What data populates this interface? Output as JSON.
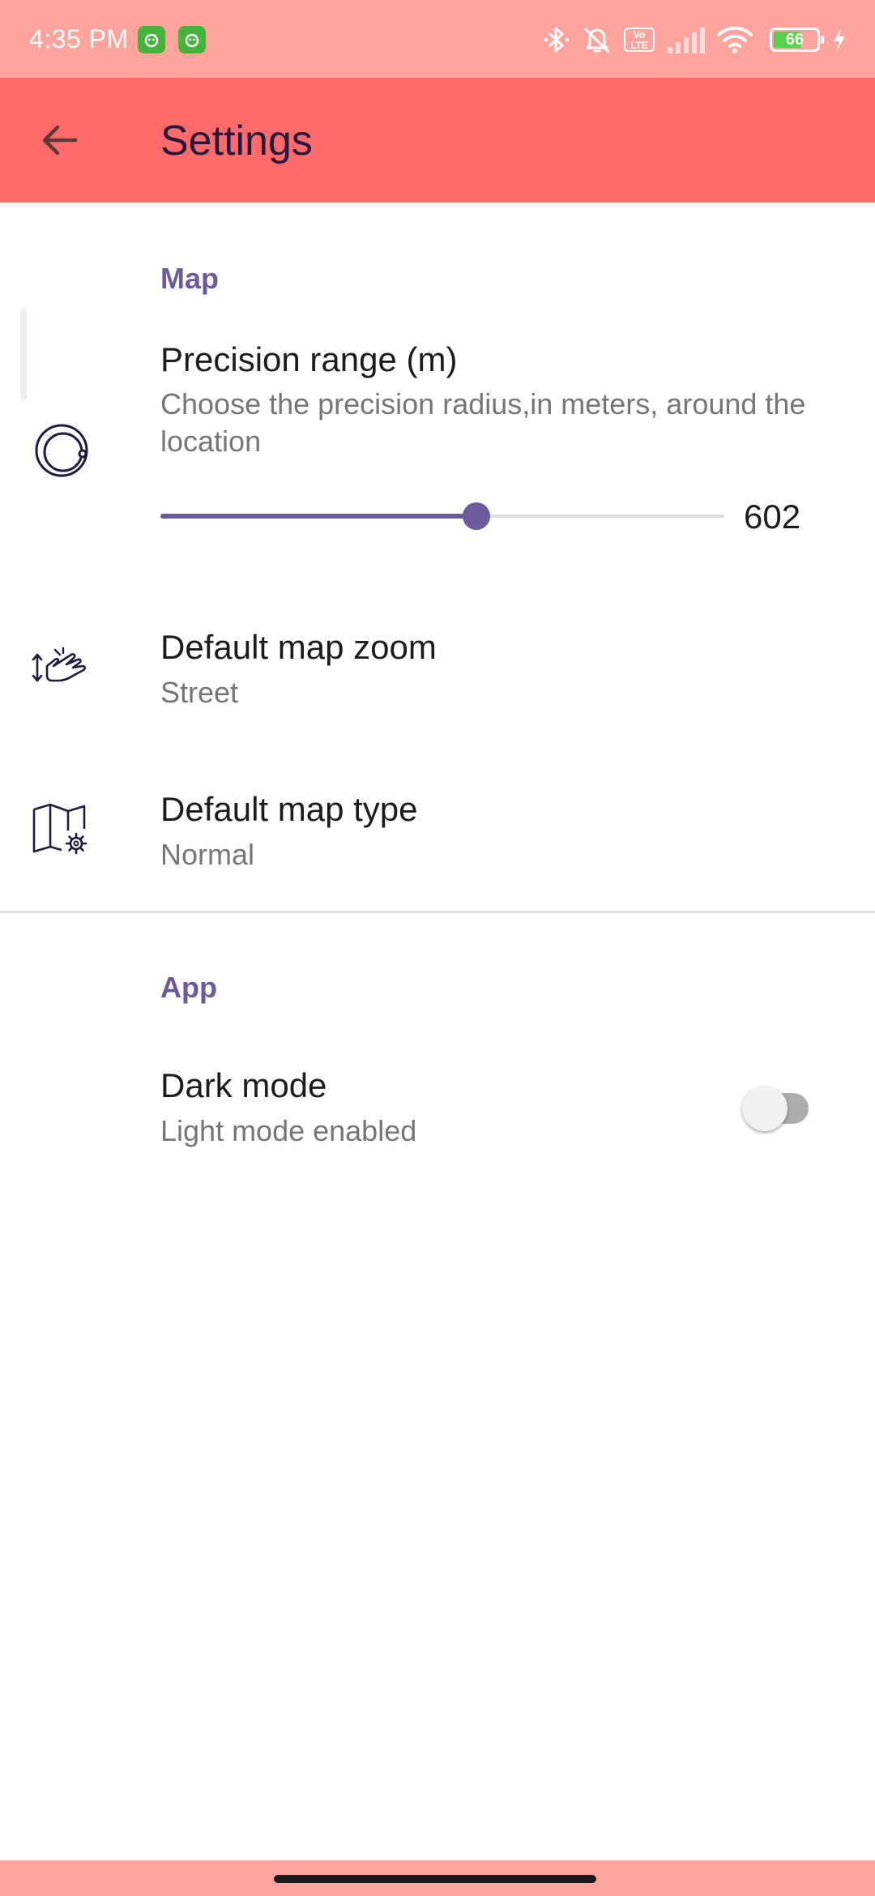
{
  "status_bar": {
    "time": "4:35 PM",
    "battery_level": "66",
    "battery_fraction": 0.66,
    "volte": "Vo\nLTE",
    "icons": [
      "app-notification-icon",
      "app-notification-icon",
      "bluetooth-icon",
      "bell-off-icon",
      "volte-icon",
      "signal-icon",
      "wifi-icon",
      "battery-icon",
      "charging-icon"
    ]
  },
  "app_bar": {
    "title": "Settings",
    "back_icon": "arrow-back-icon"
  },
  "sections": {
    "map": {
      "title": "Map",
      "precision": {
        "title": "Precision range (m)",
        "summary": "Choose the precision radius,in meters, around the location",
        "value": "602",
        "slider_fraction": 0.56,
        "icon": "radius-icon"
      },
      "zoom": {
        "title": "Default map zoom",
        "summary": "Street",
        "icon": "pinch-zoom-icon"
      },
      "type": {
        "title": "Default map type",
        "summary": "Normal",
        "icon": "map-settings-icon"
      }
    },
    "app": {
      "title": "App",
      "dark_mode": {
        "title": "Dark mode",
        "summary": "Light mode enabled",
        "enabled": false
      }
    }
  },
  "colors": {
    "status_bar": "#ffa39d",
    "app_bar": "#ff6b6b",
    "accent": "#6c5a9c",
    "title_text": "#231a3d"
  }
}
